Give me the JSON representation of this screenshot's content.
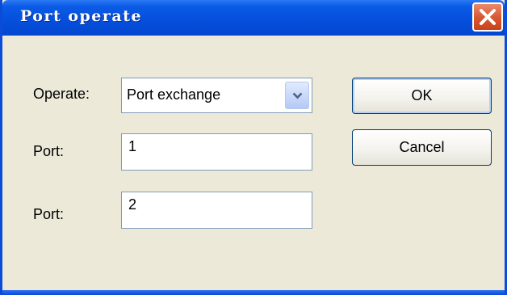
{
  "window": {
    "title": "Port operate",
    "close_icon": "close-x-icon"
  },
  "form": {
    "operate": {
      "label": "Operate:",
      "selected": "Port exchange",
      "dropdown_icon": "chevron-down-icon"
    },
    "port1": {
      "label": "Port:",
      "value": "1"
    },
    "port2": {
      "label": "Port:",
      "value": "2"
    }
  },
  "buttons": {
    "ok": "OK",
    "cancel": "Cancel"
  },
  "colors": {
    "titlebar": "#0550dd",
    "face": "#ece9d8",
    "close": "#d85a33"
  }
}
